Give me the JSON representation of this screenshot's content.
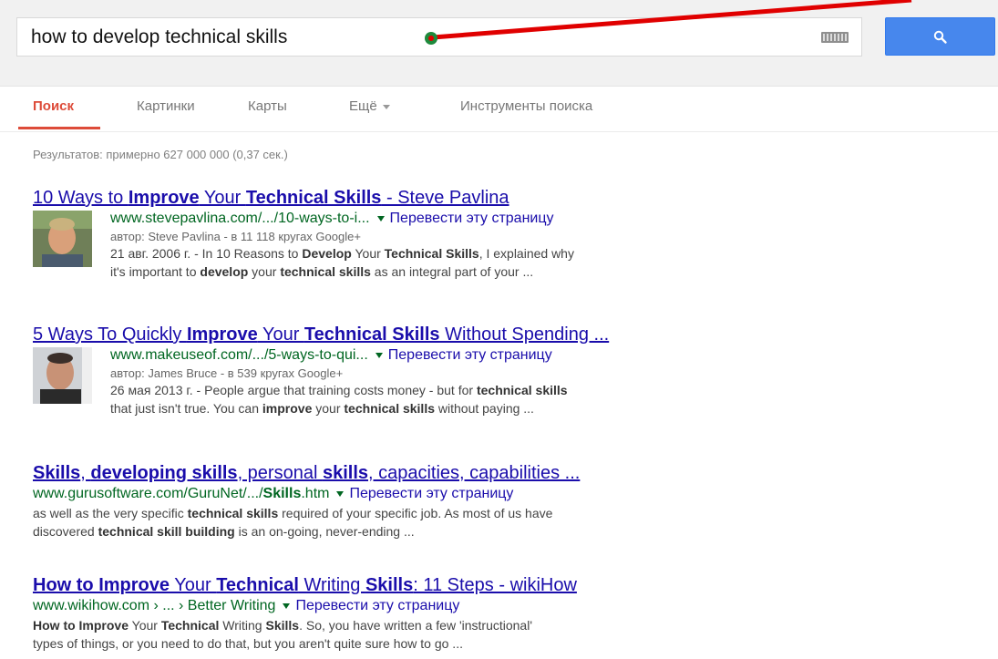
{
  "search": {
    "query": "how to develop technical skills"
  },
  "tabs": [
    {
      "label": "Поиск",
      "active": true
    },
    {
      "label": "Картинки",
      "active": false
    },
    {
      "label": "Карты",
      "active": false
    },
    {
      "label": "Ещё",
      "active": false
    },
    {
      "label": "Инструменты поиска",
      "active": false
    }
  ],
  "stats": "Результатов: примерно 627 000 000 (0,37 сек.)",
  "results": [
    {
      "title_parts": [
        "10 Ways to ",
        "Improve",
        " Your ",
        "Technical Skills",
        " - Steve Pavlina"
      ],
      "url": "www.stevepavlina.com/.../10-ways-to-i...",
      "translate": "Перевести эту страницу",
      "author": "автор: Steve Pavlina - в 11 118 кругах Google+",
      "snippet_line1_parts": [
        "21 авг. 2006 г. - In 10 Reasons to ",
        "Develop",
        " Your ",
        "Technical Skills",
        ", I explained why"
      ],
      "snippet_line2_parts": [
        "it's important to ",
        "develop",
        " your ",
        "technical skills",
        " as an integral part of your ..."
      ]
    },
    {
      "title_parts": [
        "5 Ways To Quickly ",
        "Improve",
        " Your ",
        "Technical Skills",
        " Without Spending ..."
      ],
      "url": "www.makeuseof.com/.../5-ways-to-qui...",
      "translate": "Перевести эту страницу",
      "author": "автор: James Bruce - в 539 кругах Google+",
      "snippet_line1_parts": [
        "26 мая 2013 г. - People argue that training costs money - but for ",
        "technical skills",
        ""
      ],
      "snippet_line2_parts": [
        "that just isn't true. You can ",
        "improve",
        " your ",
        "technical skills",
        " without paying ..."
      ]
    },
    {
      "title_parts": [
        "Skills",
        ", ",
        "developing skills",
        ", personal ",
        "skills",
        ", capacities, capabilities ..."
      ],
      "url_parts": [
        "www.gurusoftware.com/GuruNet/.../",
        "Skills",
        ".htm"
      ],
      "translate": "Перевести эту страницу",
      "snippet_line1_parts": [
        "as well as the very specific ",
        "technical skills",
        " required of your specific job. As most of us have"
      ],
      "snippet_line2_parts": [
        "discovered ",
        "technical skill building",
        " is an on-going, never-ending ..."
      ]
    },
    {
      "title_parts": [
        "How to Improve",
        " Your ",
        "Technical",
        " Writing ",
        "Skills",
        ": 11 Steps - wikiHow"
      ],
      "url": "www.wikihow.com › ... › Better Writing",
      "translate": "Перевести эту страницу",
      "snippet_line1_parts": [
        "How to Improve",
        " Your ",
        "Technical",
        " Writing ",
        "Skills",
        ". So, you have written a few 'instructional'"
      ],
      "snippet_line2_parts": [
        "types of things, or you need to do that, but you aren't quite sure how to go ..."
      ]
    }
  ],
  "colors": {
    "link": "#1a0dab",
    "url": "#006621",
    "active_tab": "#dd4b39",
    "search_button": "#4787ed",
    "annotation_arrow": "#e00000",
    "annotation_dot": "#1e8a3c"
  },
  "icons": [
    "search-icon",
    "keyboard-icon",
    "dropdown-caret-icon"
  ]
}
